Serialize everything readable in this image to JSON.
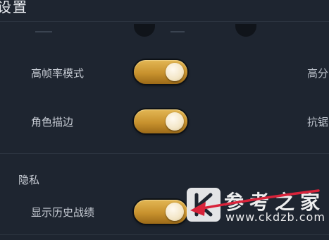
{
  "header": {
    "title": "设置"
  },
  "display": {
    "rows": [
      {
        "label": "高帧率模式",
        "right_label": "高分",
        "toggle_on": true
      },
      {
        "label": "角色描边",
        "right_label": "抗锯",
        "toggle_on": true
      }
    ]
  },
  "privacy": {
    "section_title": "隐私",
    "rows": [
      {
        "label": "显示历史战绩",
        "toggle_on": true
      }
    ]
  },
  "watermark": {
    "logo_letter": "K",
    "text": "参考之家",
    "url": "www.ckdzb.com"
  },
  "annotation": {
    "arrow_color": "#d8233a"
  },
  "colors": {
    "background": "#1e2530",
    "toggle_on": "#c8922e",
    "knob": "#f3e6c7"
  }
}
